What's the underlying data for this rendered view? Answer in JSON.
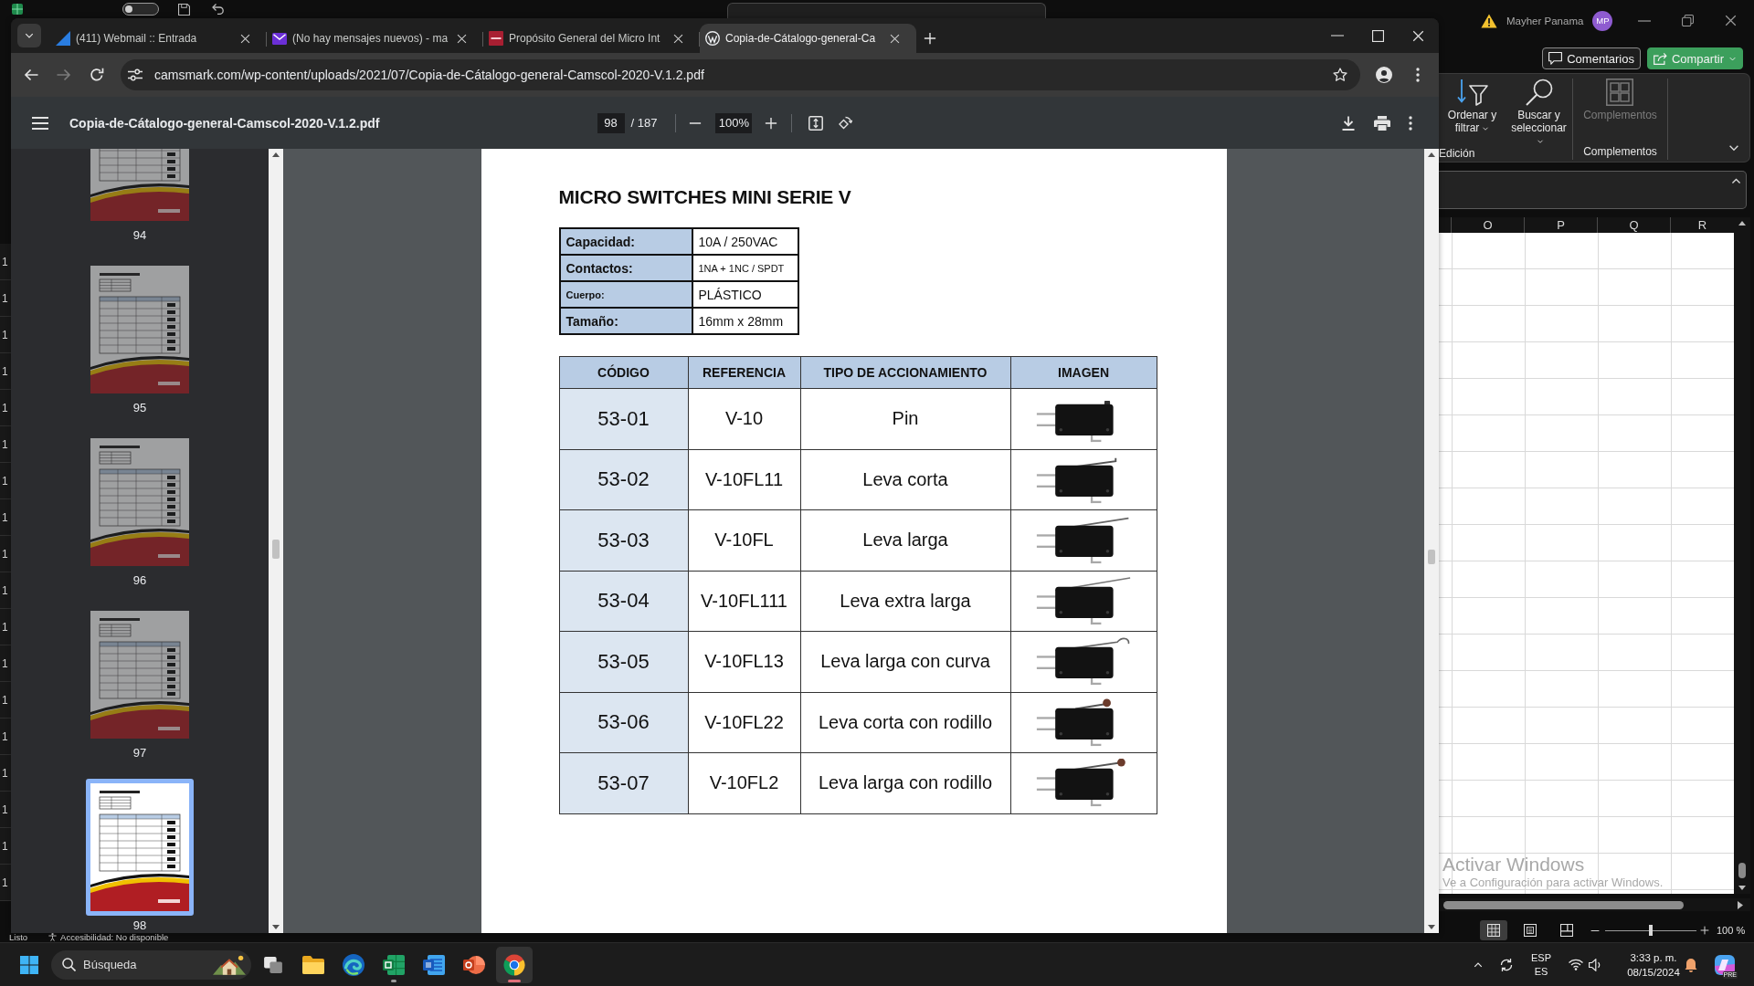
{
  "excel_window": {
    "quick_access": {
      "autosave_on": false
    },
    "account": {
      "name": "Mayher Panama",
      "initials": "MP"
    },
    "actions": [
      {
        "label": "Comentarios",
        "kind": "comments",
        "has_menu": false
      },
      {
        "label": "Compartir",
        "kind": "share",
        "has_menu": true
      }
    ],
    "ribbon": {
      "groups": [
        {
          "label": "Edición",
          "commands": [
            {
              "label": "Ordenar y filtrar",
              "kind": "sort",
              "disabled": false,
              "has_menu": true
            },
            {
              "label": "Buscar y seleccionar",
              "kind": "find",
              "disabled": false,
              "has_menu": true
            }
          ]
        },
        {
          "label": "Complementos",
          "commands": [
            {
              "label": "Complementos",
              "kind": "addins",
              "disabled": true,
              "has_menu": false
            }
          ]
        }
      ]
    },
    "sheet": {
      "columns": [
        "O",
        "P",
        "Q",
        "R"
      ],
      "row_header_fragments": [
        "1",
        "1",
        "1",
        "1",
        "1",
        "1",
        "1",
        "1",
        "1",
        "1",
        "1",
        "1",
        "1",
        "1",
        "1",
        "1",
        "1",
        "1"
      ]
    },
    "status_bar": {
      "ready": "Listo",
      "accessibility": "Accesibilidad: No disponible",
      "views": [
        {
          "kind": "normal",
          "selected": true
        },
        {
          "kind": "layout",
          "selected": false
        },
        {
          "kind": "breaks",
          "selected": false
        }
      ],
      "zoom": {
        "level": 0.5,
        "reading": "100 %"
      }
    }
  },
  "browser": {
    "tabs": [
      {
        "title": "(411) Webmail :: Entrada",
        "kind": "triangle",
        "selected": false
      },
      {
        "title": "(No hay mensajes nuevos) - ma",
        "kind": "envelope",
        "selected": false
      },
      {
        "title": "Propósito General del Micro Int",
        "kind": "square",
        "selected": false
      },
      {
        "title": "Copia-de-Cátalogo-general-Ca",
        "kind": "circle",
        "selected": true
      }
    ],
    "nav_buttons": [
      {
        "kind": "back",
        "disabled": false
      },
      {
        "kind": "forward",
        "disabled": true
      },
      {
        "kind": "reload",
        "disabled": false
      }
    ],
    "address": "camsmark.com/wp-content/uploads/2021/07/Copia-de-Cátalogo-general-Camscol-2020-V.1.2.pdf",
    "pdf_viewer": {
      "file_name": "Copia-de-Cátalogo-general-Camscol-2020-V.1.2.pdf",
      "page": "98",
      "page_total": "/ 187",
      "zoom": "100%",
      "thumbnails": [
        {
          "page": "94",
          "selected": false
        },
        {
          "page": "95",
          "selected": false
        },
        {
          "page": "96",
          "selected": false
        },
        {
          "page": "97",
          "selected": false
        },
        {
          "page": "98",
          "selected": true
        }
      ],
      "document": {
        "title": "MICRO SWITCHES MINI SERIE V",
        "specs": [
          {
            "label": "Capacidad:",
            "value": "10A / 250VAC"
          },
          {
            "label": "Contactos:",
            "value": "1NA + 1NC / SPDT"
          },
          {
            "label": "Cuerpo:",
            "value": "PLÁSTICO"
          },
          {
            "label": "Tamaño:",
            "value": "16mm x 28mm"
          }
        ],
        "table": {
          "columns": [
            "CÓDIGO",
            "REFERENCIA",
            "TIPO DE ACCIONAMIENTO",
            "IMAGEN"
          ],
          "rows": [
            {
              "code": "53-01",
              "reference": "V-10",
              "actuation": "Pin",
              "image": {
                "kind": "pin"
              }
            },
            {
              "code": "53-02",
              "reference": "V-10FL11",
              "actuation": "Leva corta",
              "image": {
                "kind": "short"
              }
            },
            {
              "code": "53-03",
              "reference": "V-10FL",
              "actuation": "Leva larga",
              "image": {
                "kind": "long"
              }
            },
            {
              "code": "53-04",
              "reference": "V-10FL111",
              "actuation": "Leva extra larga",
              "image": {
                "kind": "extralong"
              }
            },
            {
              "code": "53-05",
              "reference": "V-10FL13",
              "actuation": "Leva larga con curva",
              "image": {
                "kind": "curved"
              }
            },
            {
              "code": "53-06",
              "reference": "V-10FL22",
              "actuation": "Leva corta con rodillo",
              "image": {
                "kind": "roller"
              }
            },
            {
              "code": "53-07",
              "reference": "V-10FL2",
              "actuation": "Leva larga con rodillo",
              "image": {
                "kind": "longroller"
              }
            }
          ]
        }
      }
    }
  },
  "activation_notice": {
    "title": "Activar Windows",
    "message": "Ve a Configuración para activar Windows."
  },
  "taskbar": {
    "search": {
      "placeholder": "Búsqueda"
    },
    "apps": [
      {
        "kind": "taskview",
        "running": false,
        "active": false
      },
      {
        "kind": "explorer",
        "running": false,
        "active": false
      },
      {
        "kind": "edge",
        "running": false,
        "active": false
      },
      {
        "kind": "excel",
        "running": true,
        "active": false
      },
      {
        "kind": "word",
        "running": false,
        "active": false
      },
      {
        "kind": "powerpoint",
        "running": false,
        "active": false
      },
      {
        "kind": "chrome",
        "running": true,
        "active": true
      }
    ],
    "tray": {
      "language": "ESP",
      "layout": "ES",
      "time": "3:33 p. m.",
      "date": "08/15/2024",
      "copilot_badge": "PRE"
    }
  }
}
